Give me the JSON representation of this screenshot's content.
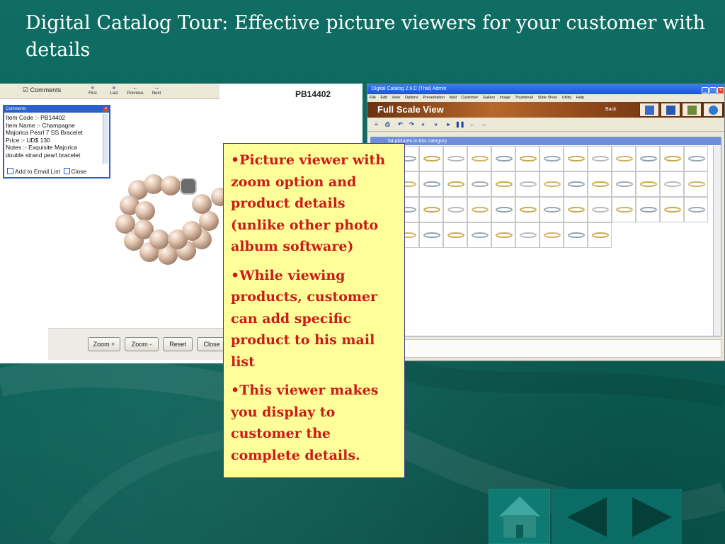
{
  "slide": {
    "title": "Digital Catalog Tour:  Effective picture viewers for your customer with details",
    "bullets": [
      "•Picture viewer with zoom option and product details (unlike other photo album software)",
      "•While viewing products, customer can add specific product to his mail list",
      "•This viewer makes you display to customer the complete details."
    ]
  },
  "picture_viewer": {
    "comments_checkbox_label": "Comments",
    "nav": [
      "First",
      "Last",
      "Previous",
      "Next"
    ],
    "item_code": "PB14402",
    "comments_panel": {
      "title": "Comments",
      "text": "Item Code :- PB14402\nItem Name :- Champagne\nMajorica Pearl 7 SS Bracelet\nPrice :- UD$ 130\nNotes :- Exquisite Majorica\ndouble strand pearl bracelet",
      "add_to_email": "Add to Email List",
      "close": "Close"
    },
    "buttons": [
      "Zoom +",
      "Zoom -",
      "Reset",
      "Close"
    ]
  },
  "catalog_window": {
    "window_title": "Digital Catalog 2.9.C (Trial)        Admin",
    "menu": [
      "File",
      "Edit",
      "View",
      "Options",
      "Presentation",
      "Mail",
      "Customer",
      "Gallery",
      "Image",
      "Thumbnail",
      "Slide Show",
      "Utility",
      "Help"
    ],
    "banner_title": "Full Scale View",
    "back_label": "Back",
    "gallery_header": "54 pictures in this category"
  },
  "colors": {
    "background": "#0d6a60",
    "callout_bg": "#ffff99",
    "callout_text": "#cc1a1a",
    "title_text": "#ffffff"
  }
}
